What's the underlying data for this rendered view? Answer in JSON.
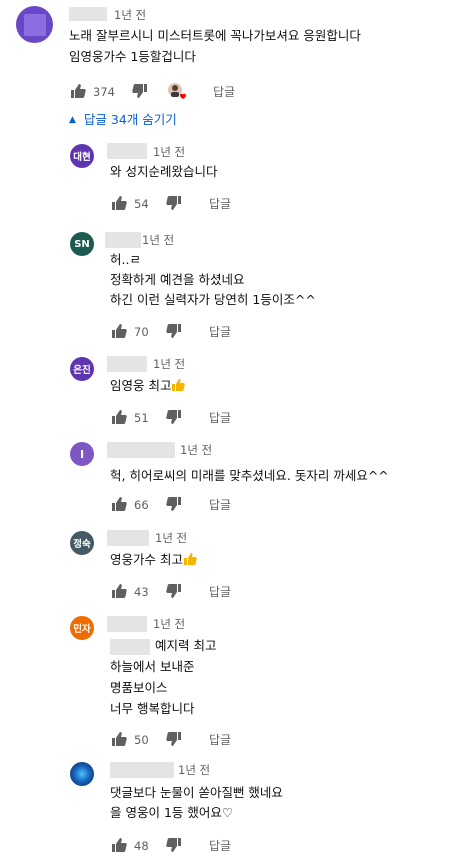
{
  "top_comment": {
    "time": "1년 전",
    "lines": [
      "노래 잘부르시니 미스터트롯에 꼭나가보셔요 응원합니다",
      "임영웅가수 1등할겁니다"
    ],
    "likes": "374",
    "reply_label": "답글",
    "avatar_color": "#6b47c7"
  },
  "replies_toggle": {
    "label": "답글 34개 숨기기",
    "chevron": "▲"
  },
  "replies": [
    {
      "avatar_text": "대현",
      "avatar_color": "#5e35b1",
      "time": "1년 전",
      "lines": [
        "와 성지순례왔습니다"
      ],
      "likes": "54",
      "reply_label": "답글"
    },
    {
      "avatar_text": "SN",
      "avatar_color": "#1e5a4f",
      "time": "1년 전",
      "lines": [
        "허..ㄹ",
        "정확하게 예견을 하셨네요",
        "하긴 이런 실력자가 당연히 1등이조^^"
      ],
      "likes": "70",
      "reply_label": "답글"
    },
    {
      "avatar_text": "은진",
      "avatar_color": "#5e35b1",
      "time": "1년 전",
      "lines": [
        "임영웅 최고"
      ],
      "emoji_line": 0,
      "likes": "51",
      "reply_label": "답글"
    },
    {
      "avatar_text": "I",
      "avatar_color": "#7e57c2",
      "time": "1년 전",
      "lines": [
        "헉, 히어로씨의 미래를 맞추셨네요. 돗자리 까세요^^"
      ],
      "likes": "66",
      "reply_label": "답글"
    },
    {
      "avatar_text": "정숙",
      "avatar_color": "#455a64",
      "time": "1년 전",
      "lines": [
        "영웅가수 최고"
      ],
      "emoji_line": 0,
      "likes": "43",
      "reply_label": "답글"
    },
    {
      "avatar_text": "민자",
      "avatar_color": "#ef6c00",
      "time": "1년 전",
      "lines": [
        "예지력 최고",
        "하늘에서 보내준",
        "명품보이스",
        "너무 행복합니다"
      ],
      "likes": "50",
      "reply_label": "답글"
    },
    {
      "avatar_text": "",
      "avatar_color": "#1a237e",
      "time": "1년 전",
      "lines": [
        "댓글보다 눈물이 쏟아질뻔 했네요",
        "을 영웅이 1등 했어요♡"
      ],
      "likes": "48",
      "reply_label": "답글"
    }
  ]
}
